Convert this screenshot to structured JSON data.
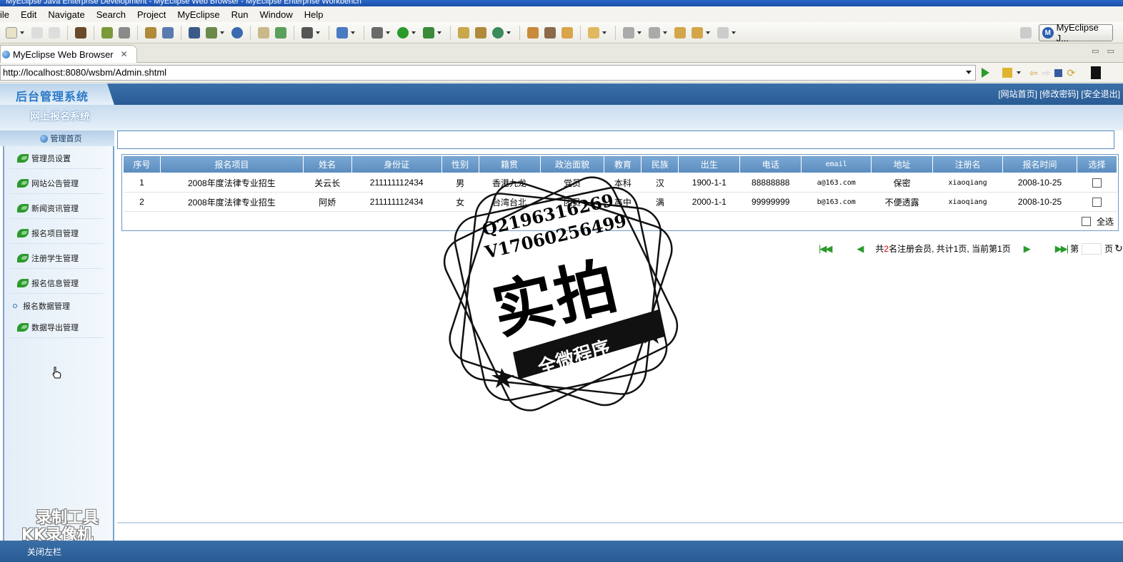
{
  "window": {
    "title": "MyEclipse Java Enterprise Development - MyEclipse Web Browser - MyEclipse Enterprise Workbench"
  },
  "menu": [
    "ile",
    "Edit",
    "Navigate",
    "Search",
    "Project",
    "MyEclipse",
    "Run",
    "Window",
    "Help"
  ],
  "perspective": {
    "label": "MyEclipse J..."
  },
  "editor_tab": {
    "label": "MyEclipse Web Browser",
    "close": "✕"
  },
  "browser": {
    "url": "http://localhost:8080/wsbm/Admin.shtml"
  },
  "site": {
    "logo": "后台管理系统",
    "top_links": "[网站首页] [修改密码] [安全退出]",
    "system_title": "网上报名系统"
  },
  "sidebar": {
    "header": "管理首页",
    "items": [
      {
        "label": "管理员设置"
      },
      {
        "label": "网站公告管理"
      },
      {
        "label": "新闻资讯管理"
      },
      {
        "label": "报名项目管理"
      },
      {
        "label": "注册学生管理"
      },
      {
        "label": "报名信息管理"
      }
    ],
    "sub_item": "报名数据管理",
    "last_item": "数据导出管理",
    "footer": "关闭左栏"
  },
  "watermark": {
    "line1": "录制工具",
    "line2": "KK录像机"
  },
  "table": {
    "headers": [
      "序号",
      "报名项目",
      "姓名",
      "身份证",
      "性别",
      "籍贯",
      "政治面貌",
      "教育",
      "民族",
      "出生",
      "电话",
      "email",
      "地址",
      "注册名",
      "报名时间",
      "选择"
    ],
    "rows": [
      [
        "1",
        "2008年度法律专业招生",
        "关云长",
        "211111112434",
        "男",
        "香港九龙",
        "党员",
        "本科",
        "汉",
        "1900-1-1",
        "88888888",
        "a@163.com",
        "保密",
        "xiaoqiang",
        "2008-10-25"
      ],
      [
        "2",
        "2008年度法律专业招生",
        "阿娇",
        "211111112434",
        "女",
        "台湾台北",
        "团员",
        "高中",
        "满",
        "2000-1-1",
        "99999999",
        "b@163.com",
        "不便透露",
        "xiaoqiang",
        "2008-10-25"
      ]
    ],
    "select_all": "全选"
  },
  "pager": {
    "prefix": "共",
    "count": "2",
    "summary": "名注册会员, 共计1页, 当前第1页",
    "page_prefix": "第",
    "page_suffix": "页"
  },
  "stamp": {
    "line1": "Q2196316269",
    "line2": "V17060256499",
    "big": "实拍",
    "ribbon": "全微程序"
  }
}
